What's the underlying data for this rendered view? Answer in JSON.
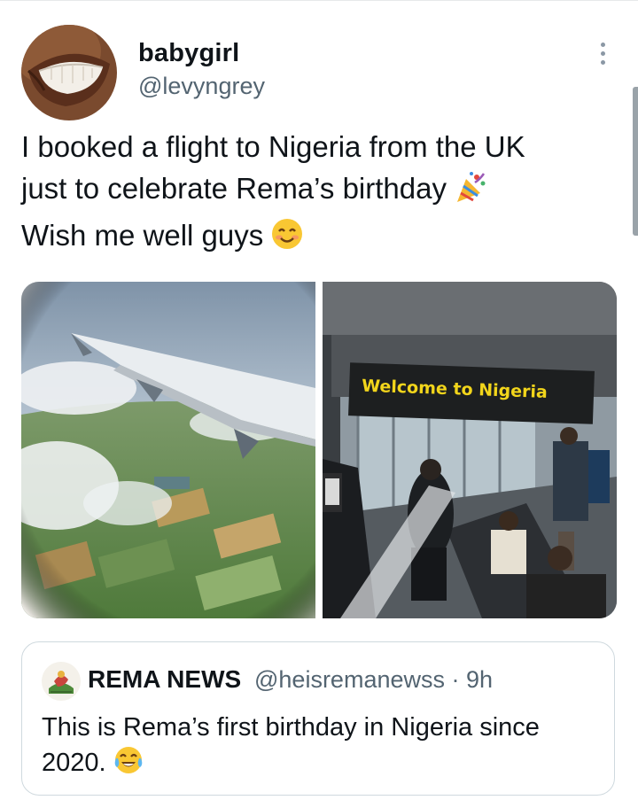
{
  "user": {
    "display_name": "babygirl",
    "handle": "@levyngrey",
    "avatar_icon": "smiling-mouth-avatar"
  },
  "menu": {
    "more_icon": "vertical-ellipsis-icon"
  },
  "tweet": {
    "line1": "I booked a flight to Nigeria from the UK",
    "line2": "just to celebrate Rema’s birthday",
    "line2_emoji": "party-popper-emoji",
    "line3": "Wish me well guys",
    "line3_emoji": "smiling-face-emoji"
  },
  "media": {
    "left_photo": "airplane-window-view-photo",
    "right_photo": "airport-arrival-photo",
    "sign_text": "Welcome to Nigeria"
  },
  "quote": {
    "name": "REMA NEWS",
    "handle_time": "@heisremanewss · 9h",
    "line1": "This is Rema’s first birthday in Nigeria since",
    "line2": "2020.",
    "line2_emoji": "tears-of-joy-emoji"
  },
  "colors": {
    "text": "#0f1419",
    "secondary": "#536471",
    "border": "#cfd9de",
    "sign_yellow": "#f2d51b"
  }
}
